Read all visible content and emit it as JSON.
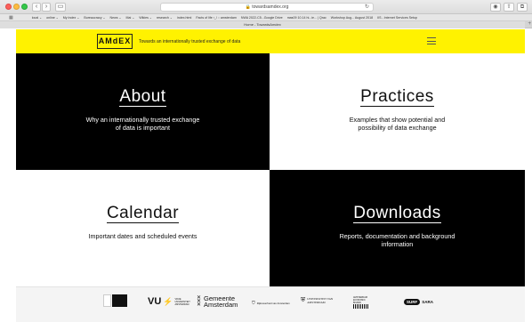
{
  "browser": {
    "address": "towardsamdex.org",
    "active_tab": "Home - TowardsAmdex",
    "nav_back": "‹",
    "nav_forward": "›",
    "bookmarks": [
      "local ⌄",
      "online ⌄",
      "My Index ⌄",
      "Bureaucracy ⌄",
      "News ⌄",
      "Mai ⌄",
      "Wikies ⌄",
      "research ⌄",
      "index.html",
      "Facts of life ›_/ :: amsterdam",
      "NWA 2022-C5...Google Drive",
      "mas09 10.14 hi...ie... | Qrac",
      "Workshop Aug... August 2018",
      "IIS - Internet Services Setup"
    ]
  },
  "site": {
    "logo": "AMdEX",
    "tagline": "Towards an internationally trusted exchange of data"
  },
  "tiles": [
    {
      "title": "About",
      "desc": "Why an internationally trusted exchange of data is important"
    },
    {
      "title": "Practices",
      "desc": "Examples that show potential and possibility of data exchange"
    },
    {
      "title": "Calendar",
      "desc": "Important dates and scheduled events"
    },
    {
      "title": "Downloads",
      "desc": "Reports, documentation and background information"
    }
  ],
  "partners": {
    "vu": "VU",
    "vu_sub": "VRIJE UNIVERSITEIT AMSTERDAM",
    "gemeente": "Gemeente Amsterdam",
    "rijksoverheid": "Rijksoverheid van Amsterdam",
    "uva": "UNIVERSITEIT VAN AMSTERDAM",
    "aeb": "AMSTERDAM ECONOMIC BOARD",
    "surf": "SURF",
    "sara": "SARA"
  }
}
